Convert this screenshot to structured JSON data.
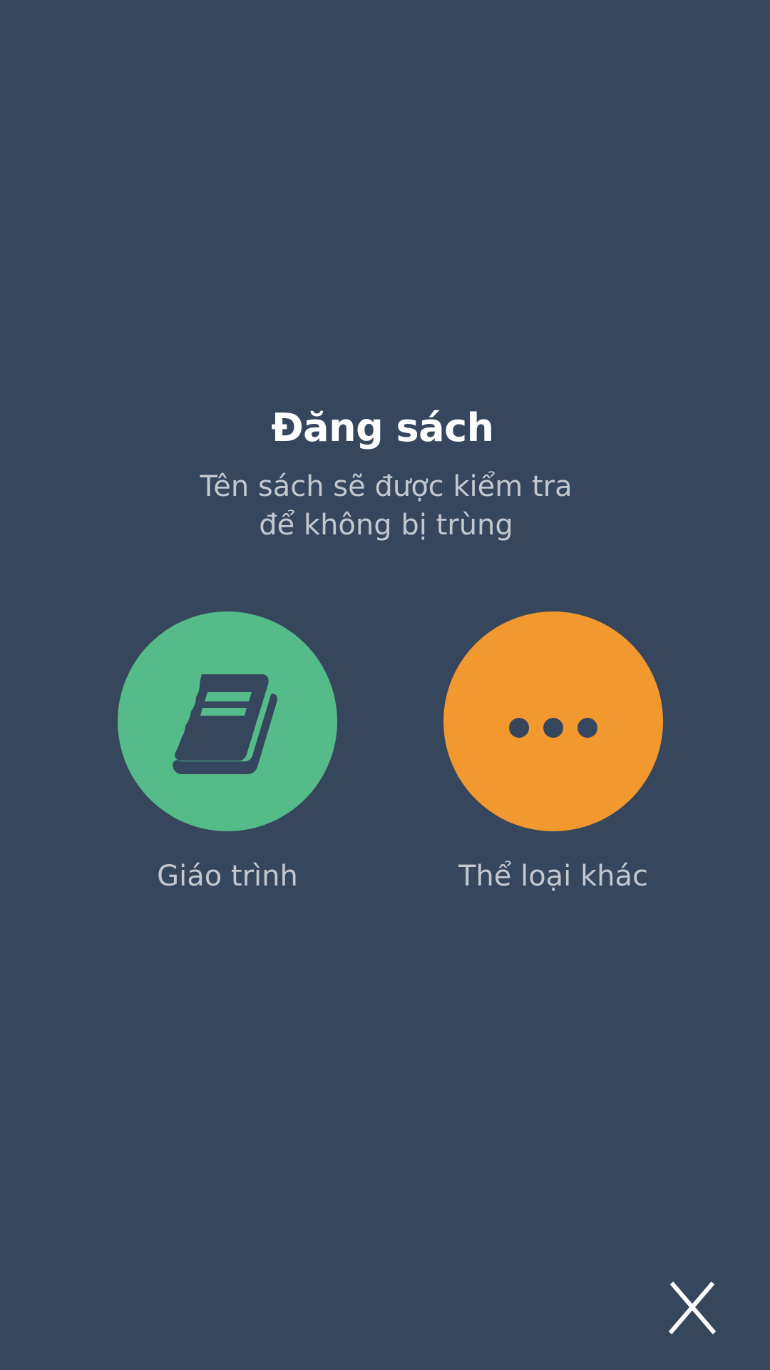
{
  "dialog": {
    "title": "Đăng sách",
    "subtitle_line1": "Tên sách sẽ được kiểm tra",
    "subtitle_line2": "để không bị trùng"
  },
  "options": [
    {
      "label": "Giáo trình",
      "icon": "book-icon",
      "color": "#55bb89"
    },
    {
      "label": "Thể loại khác",
      "icon": "more-dots-icon",
      "color": "#f1982f"
    }
  ],
  "close": {
    "icon": "close-icon"
  },
  "colors": {
    "background": "#36465d",
    "title": "#ffffff",
    "text": "#c4c7cd"
  }
}
